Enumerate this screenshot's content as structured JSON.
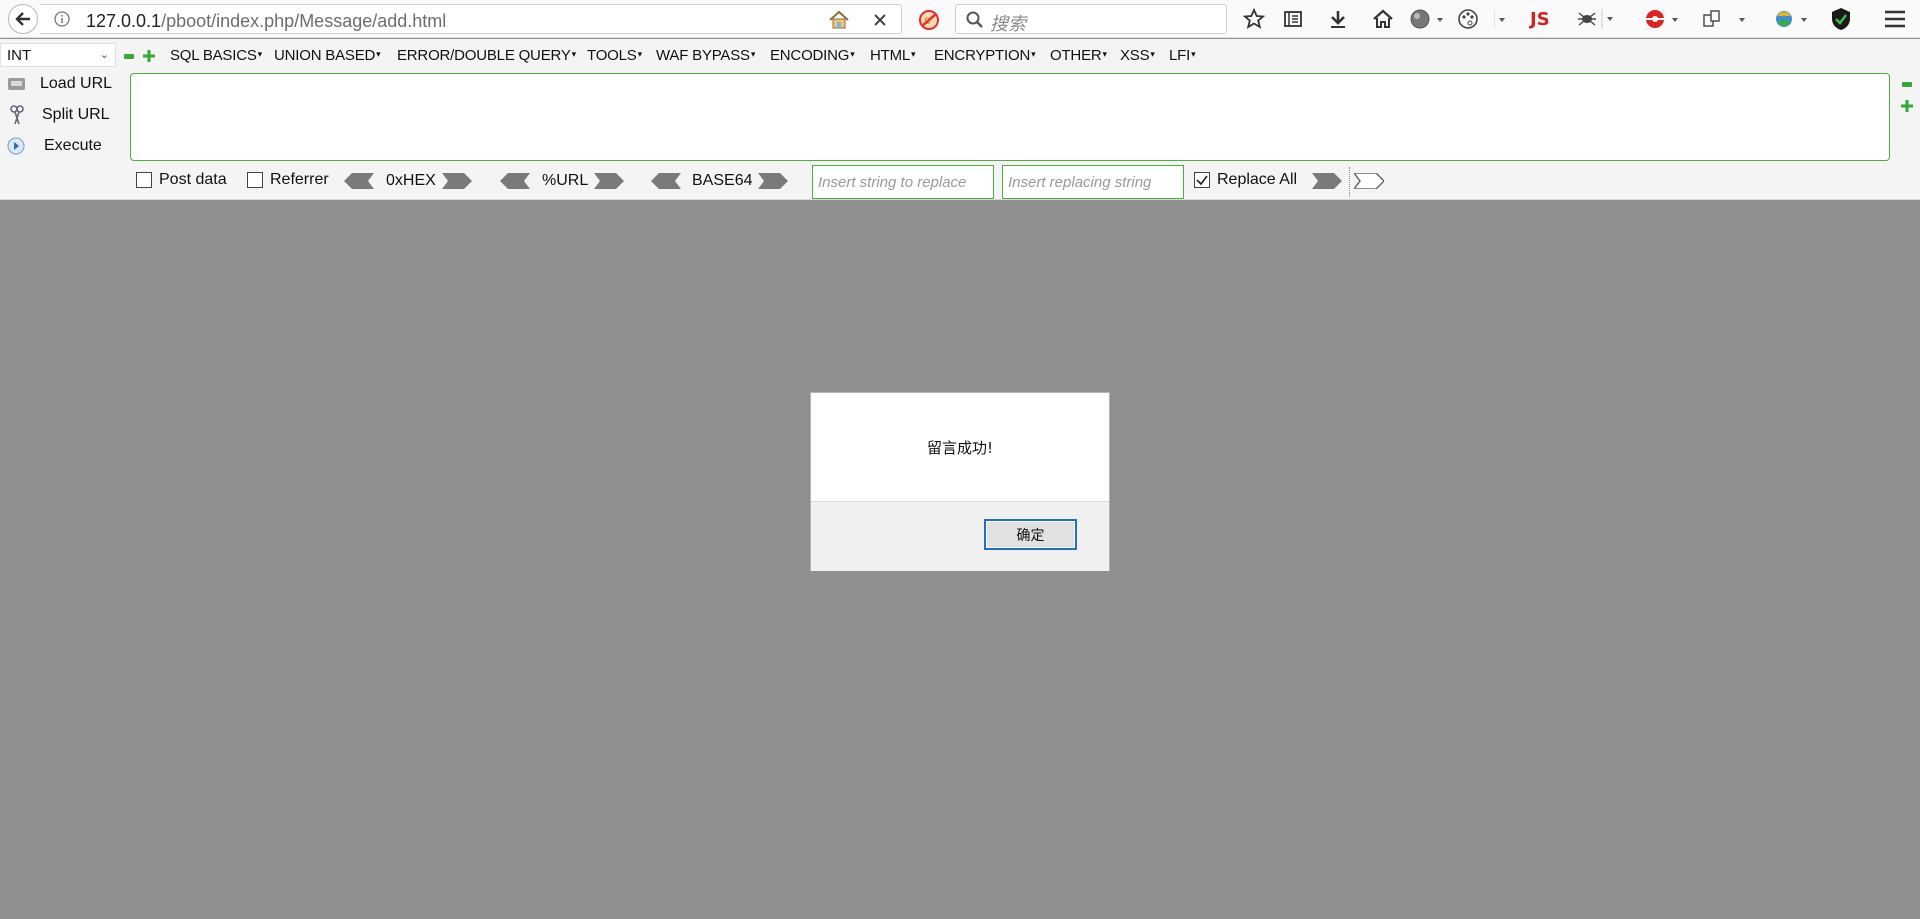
{
  "browser": {
    "url_host": "127.0.0.1",
    "url_path": "/pboot/index.php/Message/add.html",
    "search_placeholder": "搜索",
    "toolbar_icons": [
      "back-icon",
      "info-icon",
      "home-site-icon",
      "close-icon",
      "noscript-icon",
      "search-icon",
      "bookmark-star-icon",
      "reading-list-icon",
      "download-icon",
      "home-icon",
      "globe-icon",
      "palette-icon",
      "js-icon",
      "spider-icon",
      "ladybug-icon",
      "screenshot-icon",
      "google-icon",
      "shield-icon",
      "menu-icon"
    ],
    "js_label": "JS"
  },
  "hackbar": {
    "type_select": "INT",
    "menus": [
      "SQL BASICS",
      "UNION BASED",
      "ERROR/DOUBLE QUERY",
      "TOOLS",
      "WAF BYPASS",
      "ENCODING",
      "HTML",
      "ENCRYPTION",
      "OTHER",
      "XSS",
      "LFI"
    ],
    "load_url": "Load URL",
    "split_url": "Split URL",
    "execute": "Execute",
    "url_value": "",
    "post_data": "Post data",
    "referrer": "Referrer",
    "hex": "0xHEX",
    "url_enc": "%URL",
    "base64": "BASE64",
    "replace_placeholder": "Insert string to replace",
    "replacing_placeholder": "Insert replacing string",
    "replace_all": "Replace All",
    "post_checked": false,
    "referrer_checked": false,
    "replace_all_checked": true,
    "accent_color": "#4caf3a"
  },
  "dialog": {
    "message": "留言成功!",
    "ok_label": "确定"
  }
}
